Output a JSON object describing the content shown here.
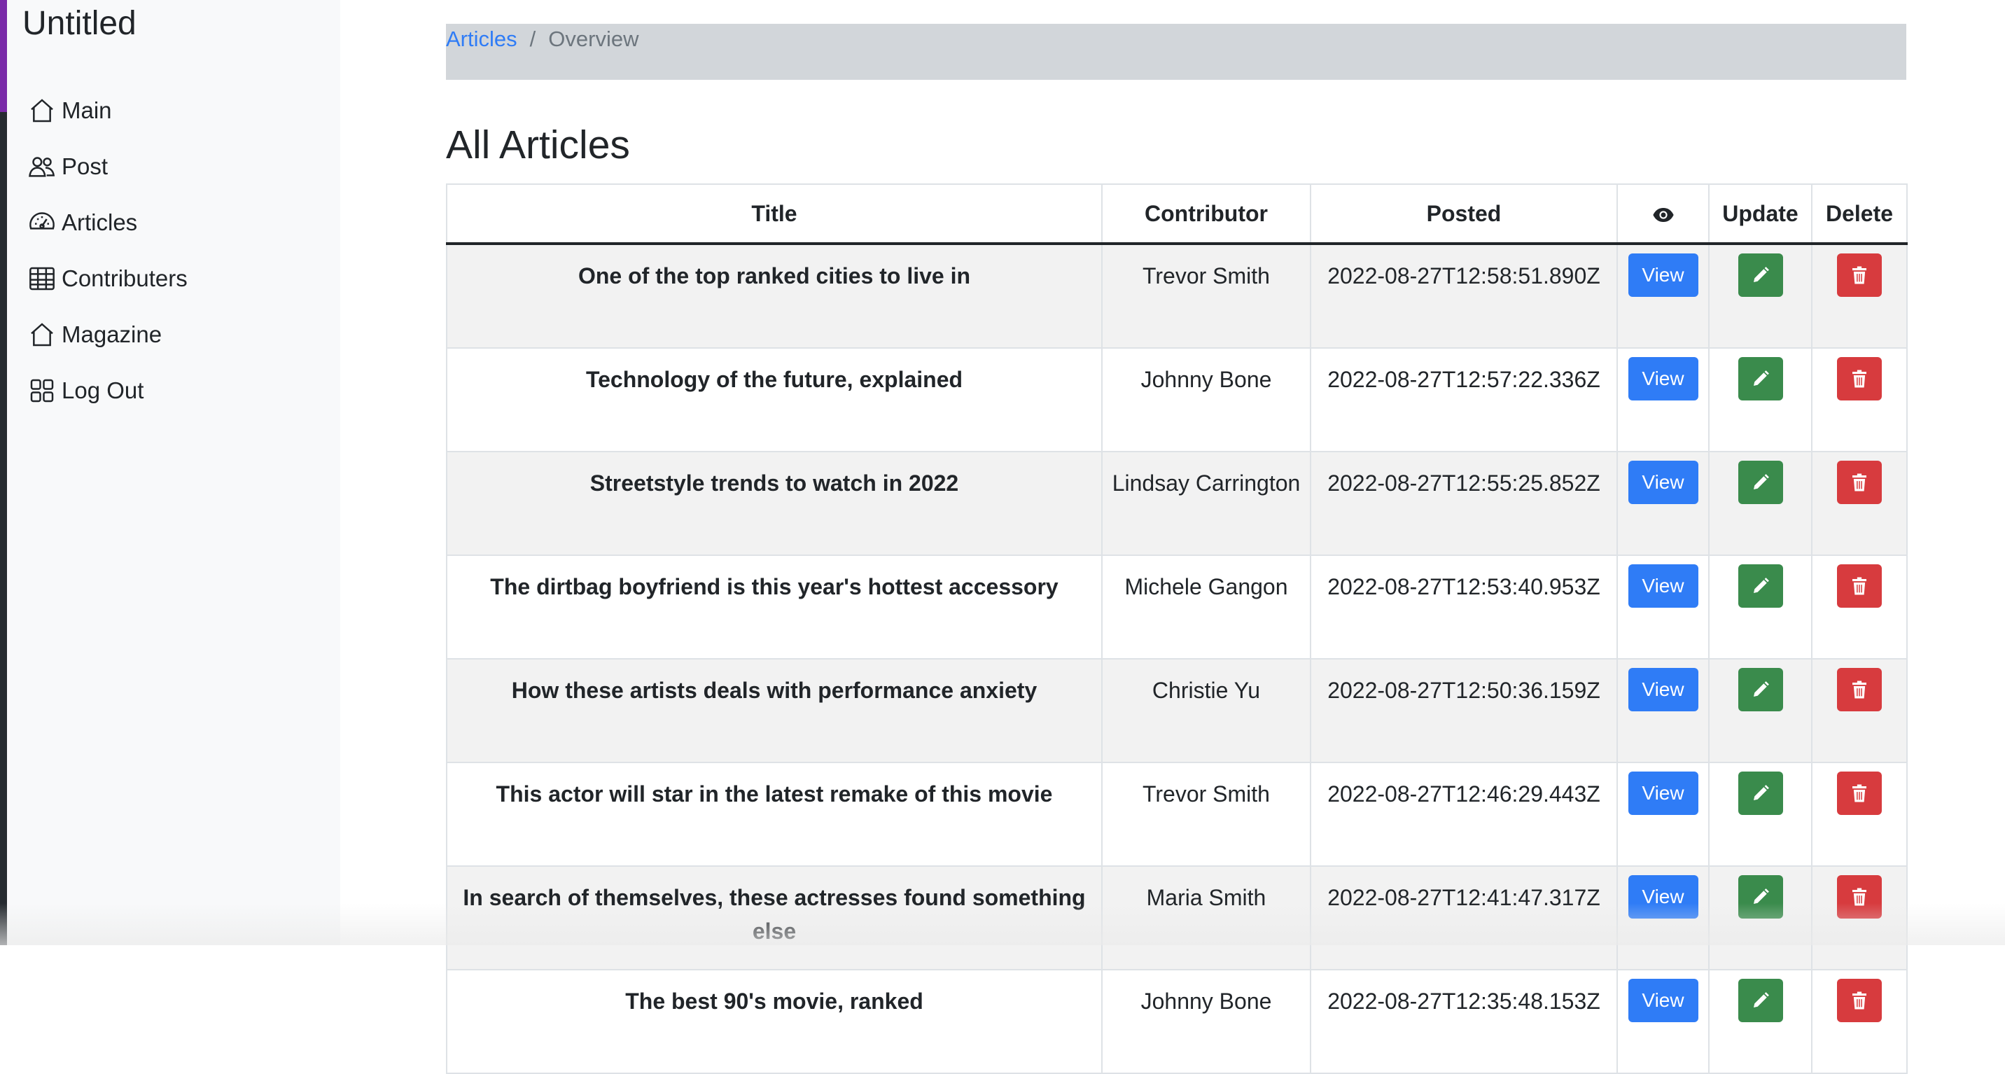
{
  "app": {
    "title": "Untitled"
  },
  "sidebar": {
    "items": [
      {
        "label": "Main",
        "icon": "home-icon"
      },
      {
        "label": "Post",
        "icon": "people-icon"
      },
      {
        "label": "Articles",
        "icon": "speedometer-icon"
      },
      {
        "label": "Contributers",
        "icon": "table-icon"
      },
      {
        "label": "Magazine",
        "icon": "home-icon"
      },
      {
        "label": "Log Out",
        "icon": "grid-icon"
      }
    ]
  },
  "breadcrumb": {
    "link": "Articles",
    "separator": "/",
    "current": "Overview"
  },
  "page": {
    "title": "All Articles"
  },
  "table": {
    "headers": {
      "title": "Title",
      "contributor": "Contributor",
      "posted": "Posted",
      "view_icon": "eye-icon",
      "update": "Update",
      "delete": "Delete"
    },
    "view_label": "View",
    "rows": [
      {
        "title": "One of the top ranked cities to live in",
        "contributor": "Trevor Smith",
        "posted": "2022-08-27T12:58:51.890Z"
      },
      {
        "title": "Technology of the future, explained",
        "contributor": "Johnny Bone",
        "posted": "2022-08-27T12:57:22.336Z"
      },
      {
        "title": "Streetstyle trends to watch in 2022",
        "contributor": "Lindsay Carrington",
        "posted": "2022-08-27T12:55:25.852Z"
      },
      {
        "title": "The dirtbag boyfriend is this year's hottest accessory",
        "contributor": "Michele Gangon",
        "posted": "2022-08-27T12:53:40.953Z"
      },
      {
        "title": "How these artists deals with performance anxiety",
        "contributor": "Christie Yu",
        "posted": "2022-08-27T12:50:36.159Z"
      },
      {
        "title": "This actor will star in the latest remake of this movie",
        "contributor": "Trevor Smith",
        "posted": "2022-08-27T12:46:29.443Z"
      },
      {
        "title": "In search of themselves, these actresses found something else",
        "contributor": "Maria Smith",
        "posted": "2022-08-27T12:41:47.317Z"
      },
      {
        "title": "The best 90's movie, ranked",
        "contributor": "Johnny Bone",
        "posted": "2022-08-27T12:35:48.153Z"
      }
    ]
  },
  "colors": {
    "primary": "#2f7cf6",
    "success": "#3a8b4c",
    "danger": "#d73b3e",
    "breadcrumb_bg": "#d2d6da"
  }
}
